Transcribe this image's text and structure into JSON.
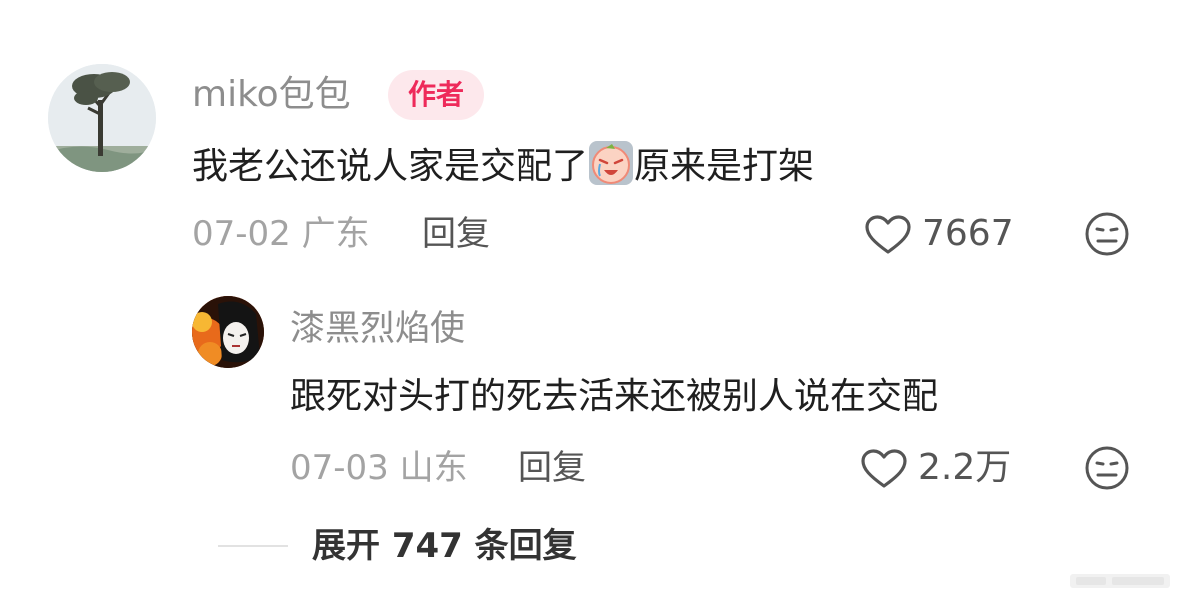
{
  "comment": {
    "username": "miko包包",
    "badge": "作者",
    "text_before_emoji": "我老公还说人家是交配了",
    "emoji": "sob-emoji",
    "text_after_emoji": "原来是打架",
    "date": "07-02",
    "location": "广东",
    "reply_label": "回复",
    "like_count": "7667",
    "like_icon": "heart-icon",
    "dislike_icon": "meh-face-icon"
  },
  "reply": {
    "username": "漆黑烈焰使",
    "text": "跟死对头打的死去活来还被别人说在交配",
    "date": "07-03",
    "location": "山东",
    "reply_label": "回复",
    "like_count": "2.2万",
    "like_icon": "heart-icon",
    "dislike_icon": "meh-face-icon"
  },
  "expand": {
    "label": "展开 747 条回复"
  },
  "colors": {
    "username": "#8d8d8d",
    "badge_bg": "#fde8ec",
    "badge_text": "#ee2a5a",
    "meta": "#a3a3a3",
    "body": "#1f1f1f"
  }
}
